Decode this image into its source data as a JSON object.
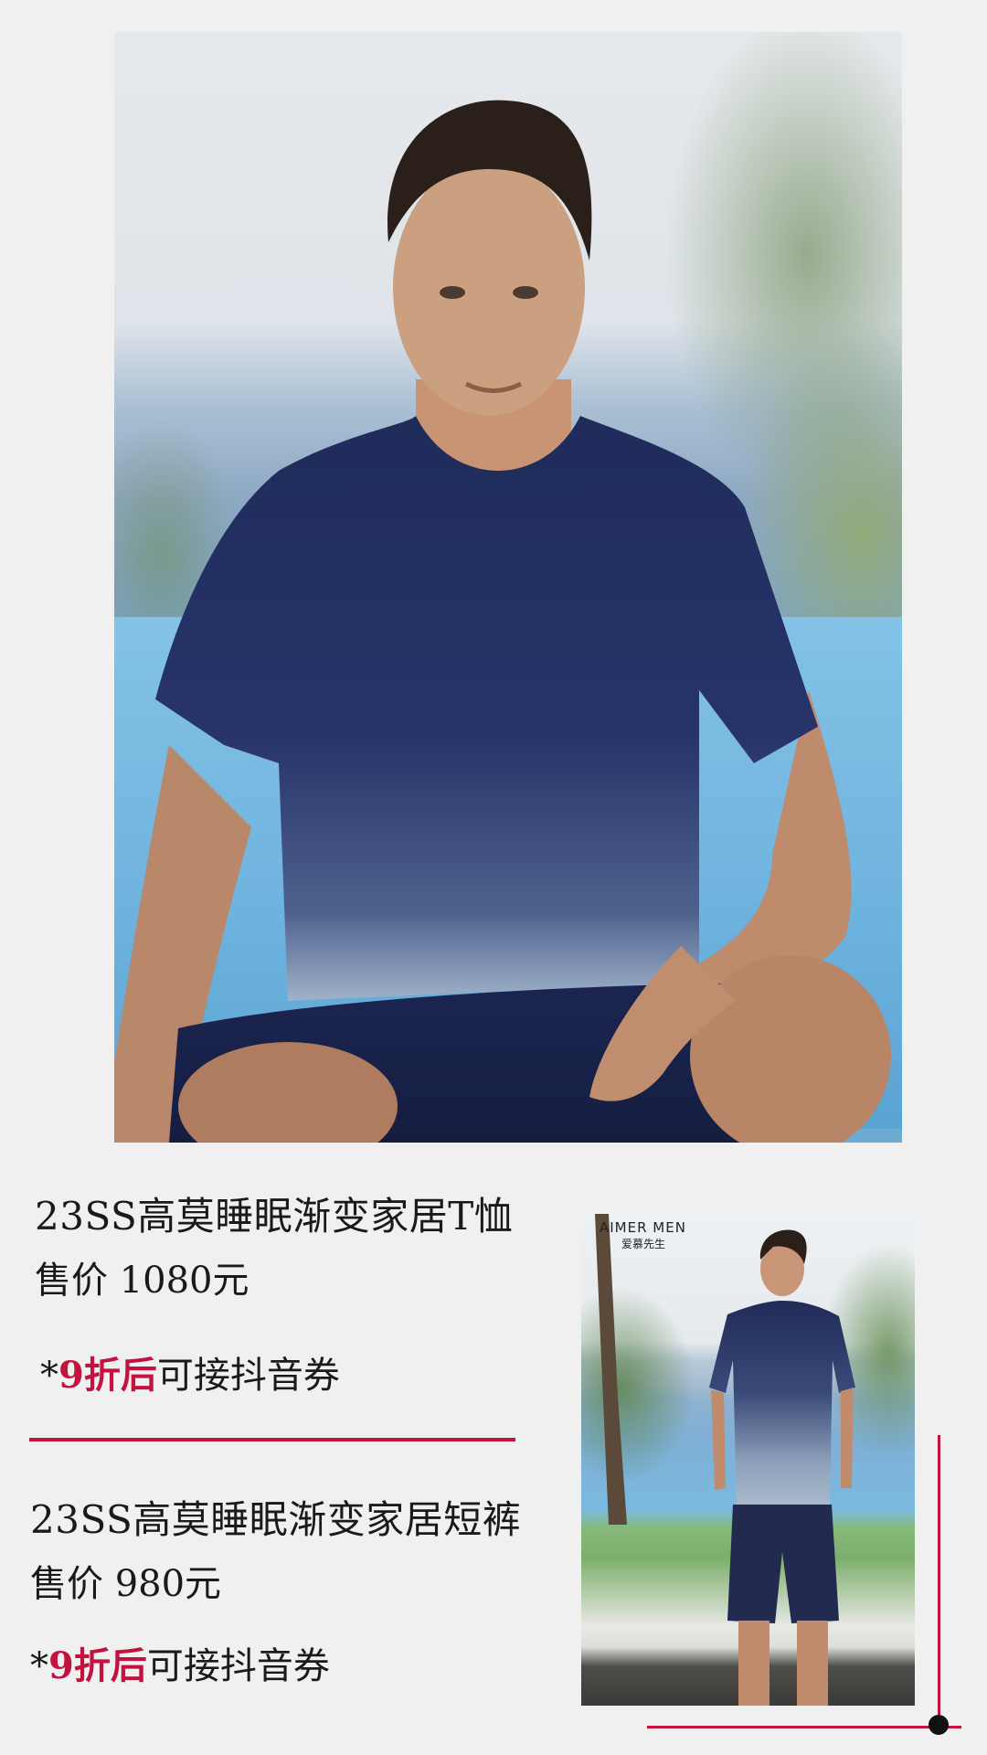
{
  "hero": {
    "alt": "man in navy gradient t-shirt and shorts seated outdoors"
  },
  "products": [
    {
      "name": "23SS高莫睡眠渐变家居T恤",
      "price": "售价 1080元",
      "promo_prefix": "*",
      "promo_highlight": "9折后",
      "promo_suffix": "可接抖音券"
    },
    {
      "name": "23SS高莫睡眠渐变家居短裤",
      "price": "售价 980元",
      "promo_prefix": "*",
      "promo_highlight": "9折后",
      "promo_suffix": "可接抖音券"
    }
  ],
  "thumbnail": {
    "brand_en": "AIMER MEN",
    "brand_cn": "爱慕先生"
  },
  "colors": {
    "accent": "#c4123f",
    "background": "#f0f0f0",
    "text": "#1a1a1a"
  }
}
